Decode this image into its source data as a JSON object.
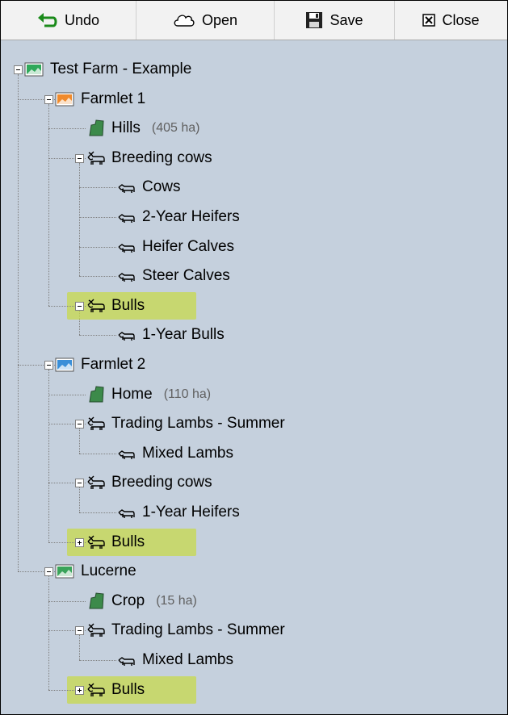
{
  "toolbar": {
    "undo": "Undo",
    "open": "Open",
    "save": "Save",
    "close": "Close"
  },
  "tree": {
    "root": "Test Farm - Example",
    "farmlets": [
      {
        "label": "Farmlet 1",
        "paddock": {
          "label": "Hills",
          "area": "(405 ha)"
        },
        "groups": [
          {
            "label": "Breeding cows",
            "children": [
              "Cows",
              "2-Year Heifers",
              "Heifer Calves",
              "Steer Calves"
            ]
          },
          {
            "label": "Bulls",
            "children": [
              "1-Year Bulls"
            ]
          }
        ]
      },
      {
        "label": "Farmlet 2",
        "paddock": {
          "label": "Home",
          "area": "(110 ha)"
        },
        "groups": [
          {
            "label": "Trading Lambs - Summer",
            "children": [
              "Mixed Lambs"
            ]
          },
          {
            "label": "Breeding cows",
            "children": [
              "1-Year Heifers"
            ]
          },
          {
            "label": "Bulls",
            "children": []
          }
        ]
      },
      {
        "label": "Lucerne",
        "paddock": {
          "label": "Crop",
          "area": "(15 ha)"
        },
        "groups": [
          {
            "label": "Trading Lambs - Summer",
            "children": [
              "Mixed Lambs"
            ]
          },
          {
            "label": "Bulls",
            "children": []
          }
        ]
      }
    ]
  },
  "colors": {
    "background": "#c5d0dd",
    "highlight": "#c7d94b",
    "farmlet1_icon": "#f08a2c",
    "farmlet2_icon": "#3a8fd8",
    "lucerne_icon": "#3aa35a",
    "root_icon": "#2fa85a",
    "paddock_icon": "#3c8a4a"
  }
}
